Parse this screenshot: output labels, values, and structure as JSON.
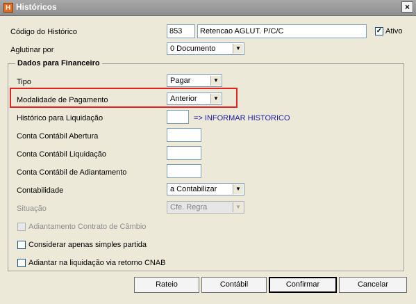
{
  "window": {
    "title": "Históricos",
    "app_icon_letter": "H",
    "close_glyph": "×"
  },
  "header": {
    "codigo_label": "Código do Histórico",
    "codigo_value": "853",
    "descricao_value": "Retencao AGLUT. P/C/C",
    "ativo_label": "Ativo",
    "ativo_checked": true,
    "aglutinar_label": "Aglutinar por",
    "aglutinar_value": "0 Documento"
  },
  "group": {
    "title": "Dados para Financeiro",
    "tipo_label": "Tipo",
    "tipo_value": "Pagar",
    "modalidade_label": "Modalidade de Pagamento",
    "modalidade_value": "Anterior",
    "historico_liq_label": "Histórico para Liquidação",
    "historico_liq_value": "",
    "historico_liq_hint": "=> INFORMAR HISTORICO",
    "conta_abertura_label": "Conta Contábil Abertura",
    "conta_liquidacao_label": "Conta Contábil Liquidação",
    "conta_adiantamento_label": "Conta Contábil de Adiantamento",
    "contabilidade_label": "Contabilidade",
    "contabilidade_value": "a Contabilizar",
    "situacao_label": "Situação",
    "situacao_value": "Cfe. Regra",
    "adiantamento_contrato_label": "Adiantamento Contrato de Câmbio",
    "considerar_simples_label": "Considerar apenas simples partida",
    "adiantar_liquidacao_label": "Adiantar na liquidação via retorno CNAB"
  },
  "buttons": {
    "rateio": "Rateio",
    "contabil": "Contábil",
    "confirmar": "Confirmar",
    "cancelar": "Cancelar"
  },
  "colors": {
    "highlight": "#e32222",
    "hint_text": "#1a1aa0",
    "titlebar": "#9a9a9a"
  },
  "dropdown_arrow": "▼"
}
